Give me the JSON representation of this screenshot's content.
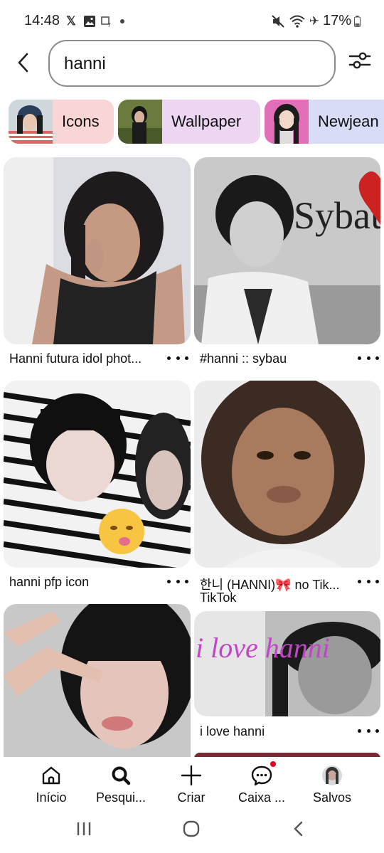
{
  "status_bar": {
    "time": "14:48",
    "battery": "17%"
  },
  "search": {
    "query": "hanni"
  },
  "chips": [
    {
      "label": "Icons",
      "color": "#f9d5d5"
    },
    {
      "label": "Wallpaper",
      "color": "#ecd6f2"
    },
    {
      "label": "Newjean",
      "color": "#d9dcf7"
    }
  ],
  "pins": [
    {
      "title": "Hanni futura idol phot...",
      "subtitle": ""
    },
    {
      "title": "#hanni :: sybau",
      "subtitle": ""
    },
    {
      "title": "hanni pfp icon",
      "subtitle": ""
    },
    {
      "title": "한니 (HANNI)🎀 no Tik...",
      "subtitle": "TikTok"
    },
    {
      "title": "",
      "subtitle": ""
    },
    {
      "title": "i love hanni",
      "subtitle": ""
    }
  ],
  "pin_overlays": {
    "sybau_text": "Sybau",
    "ilovehanni_text": "i love hanni"
  },
  "nav": [
    {
      "label": "Início"
    },
    {
      "label": "Pesqui..."
    },
    {
      "label": "Criar"
    },
    {
      "label": "Caixa ..."
    },
    {
      "label": "Salvos"
    }
  ],
  "colors": {
    "accent_red": "#e60023"
  }
}
